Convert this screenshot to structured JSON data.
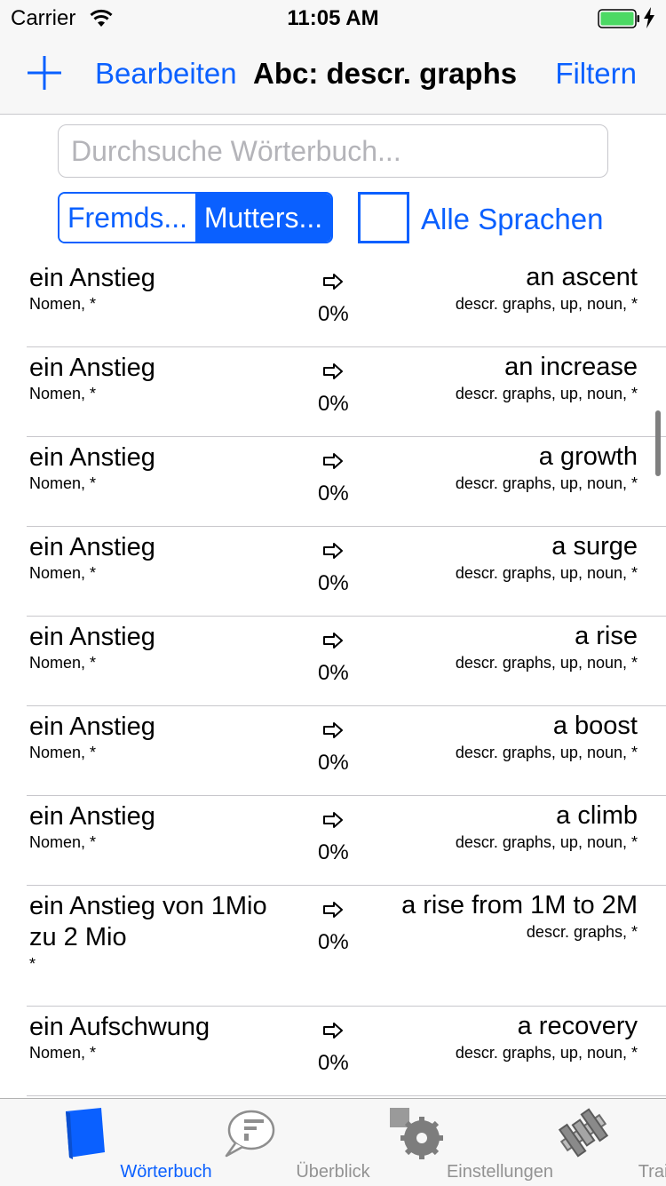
{
  "status": {
    "carrier": "Carrier",
    "time": "11:05 AM"
  },
  "nav": {
    "edit": "Bearbeiten",
    "title": "Abc: descr. graphs",
    "filter": "Filtern"
  },
  "search": {
    "placeholder": "Durchsuche Wörterbuch..."
  },
  "segments": {
    "foreign": "Fremds...",
    "native": "Mutters..."
  },
  "all_languages": "Alle Sprachen",
  "rows": [
    {
      "term": "ein Anstieg",
      "meta": "Nomen, *",
      "percent": "0%",
      "translation": "an ascent",
      "tags": "descr. graphs, up, noun, *"
    },
    {
      "term": "ein Anstieg",
      "meta": "Nomen, *",
      "percent": "0%",
      "translation": "an increase",
      "tags": "descr. graphs, up, noun, *"
    },
    {
      "term": "ein Anstieg",
      "meta": "Nomen, *",
      "percent": "0%",
      "translation": "a growth",
      "tags": "descr. graphs, up, noun, *"
    },
    {
      "term": "ein Anstieg",
      "meta": "Nomen, *",
      "percent": "0%",
      "translation": "a surge",
      "tags": "descr. graphs, up, noun, *"
    },
    {
      "term": "ein Anstieg",
      "meta": "Nomen, *",
      "percent": "0%",
      "translation": "a rise",
      "tags": "descr. graphs, up, noun, *"
    },
    {
      "term": "ein Anstieg",
      "meta": "Nomen, *",
      "percent": "0%",
      "translation": "a boost",
      "tags": "descr. graphs, up, noun, *"
    },
    {
      "term": "ein Anstieg",
      "meta": "Nomen, *",
      "percent": "0%",
      "translation": "a climb",
      "tags": "descr. graphs, up, noun, *"
    },
    {
      "term": "ein Anstieg von 1Mio zu 2 Mio",
      "meta": "*",
      "percent": "0%",
      "translation": "a rise from 1M to 2M",
      "tags": "descr. graphs, *"
    },
    {
      "term": "ein Aufschwung",
      "meta": "Nomen, *",
      "percent": "0%",
      "translation": "a recovery",
      "tags": "descr. graphs, up, noun, *"
    }
  ],
  "tabs": [
    {
      "label": "Wörterbuch",
      "icon": "book-icon"
    },
    {
      "label": "Überblick",
      "icon": "speech-bubble-icon"
    },
    {
      "label": "Einstellungen",
      "icon": "gear-icon"
    },
    {
      "label": "Trainer",
      "icon": "dumbbell-icon"
    }
  ],
  "colors": {
    "accent": "#0a60ff",
    "battery": "#4cd964"
  }
}
